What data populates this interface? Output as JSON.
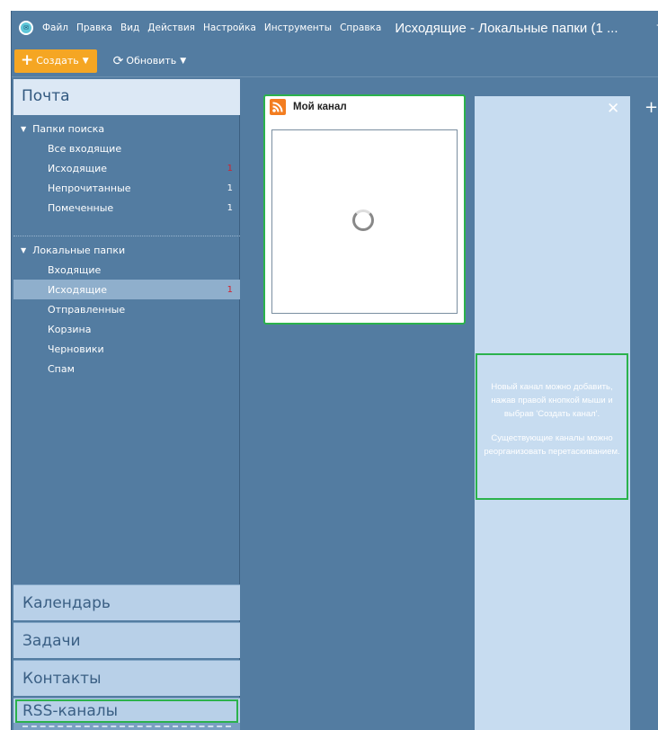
{
  "app": {
    "icon_name": "mail-app-icon",
    "menu": [
      "Файл",
      "Правка",
      "Вид",
      "Действия",
      "Настройка",
      "Инструменты",
      "Справка"
    ],
    "window_title": "Исходящие - Локальные папки (1 ..."
  },
  "toolbar": {
    "create_label": "Создать",
    "refresh_label": "Обновить"
  },
  "sidebar": {
    "mail_header": "Почта",
    "search_group": {
      "title": "Папки поиска",
      "items": [
        {
          "label": "Все входящие",
          "count": ""
        },
        {
          "label": "Исходящие",
          "count": "1"
        },
        {
          "label": "Непрочитанные",
          "count": "1"
        },
        {
          "label": "Помеченные",
          "count": "1"
        }
      ]
    },
    "local_group": {
      "title": "Локальные папки",
      "items": [
        {
          "label": "Входящие",
          "count": ""
        },
        {
          "label": "Исходящие",
          "count": "1"
        },
        {
          "label": "Отправленные",
          "count": ""
        },
        {
          "label": "Корзина",
          "count": ""
        },
        {
          "label": "Черновики",
          "count": ""
        },
        {
          "label": "Спам",
          "count": ""
        }
      ]
    },
    "panes": [
      "Календарь",
      "Задачи",
      "Контакты",
      "RSS-каналы"
    ]
  },
  "feed": {
    "title": "Мой канал"
  },
  "hint": {
    "line1": "Новый канал можно добавить, нажав правой кнопкой мыши и выбрав 'Создать канал'.",
    "line2": "Существующие каналы можно реорганизовать перетаскиванием."
  },
  "colors": {
    "accent": "#f5a623",
    "background": "#537ca1",
    "highlight": "#2bb24c",
    "count_red": "#d0222e"
  }
}
